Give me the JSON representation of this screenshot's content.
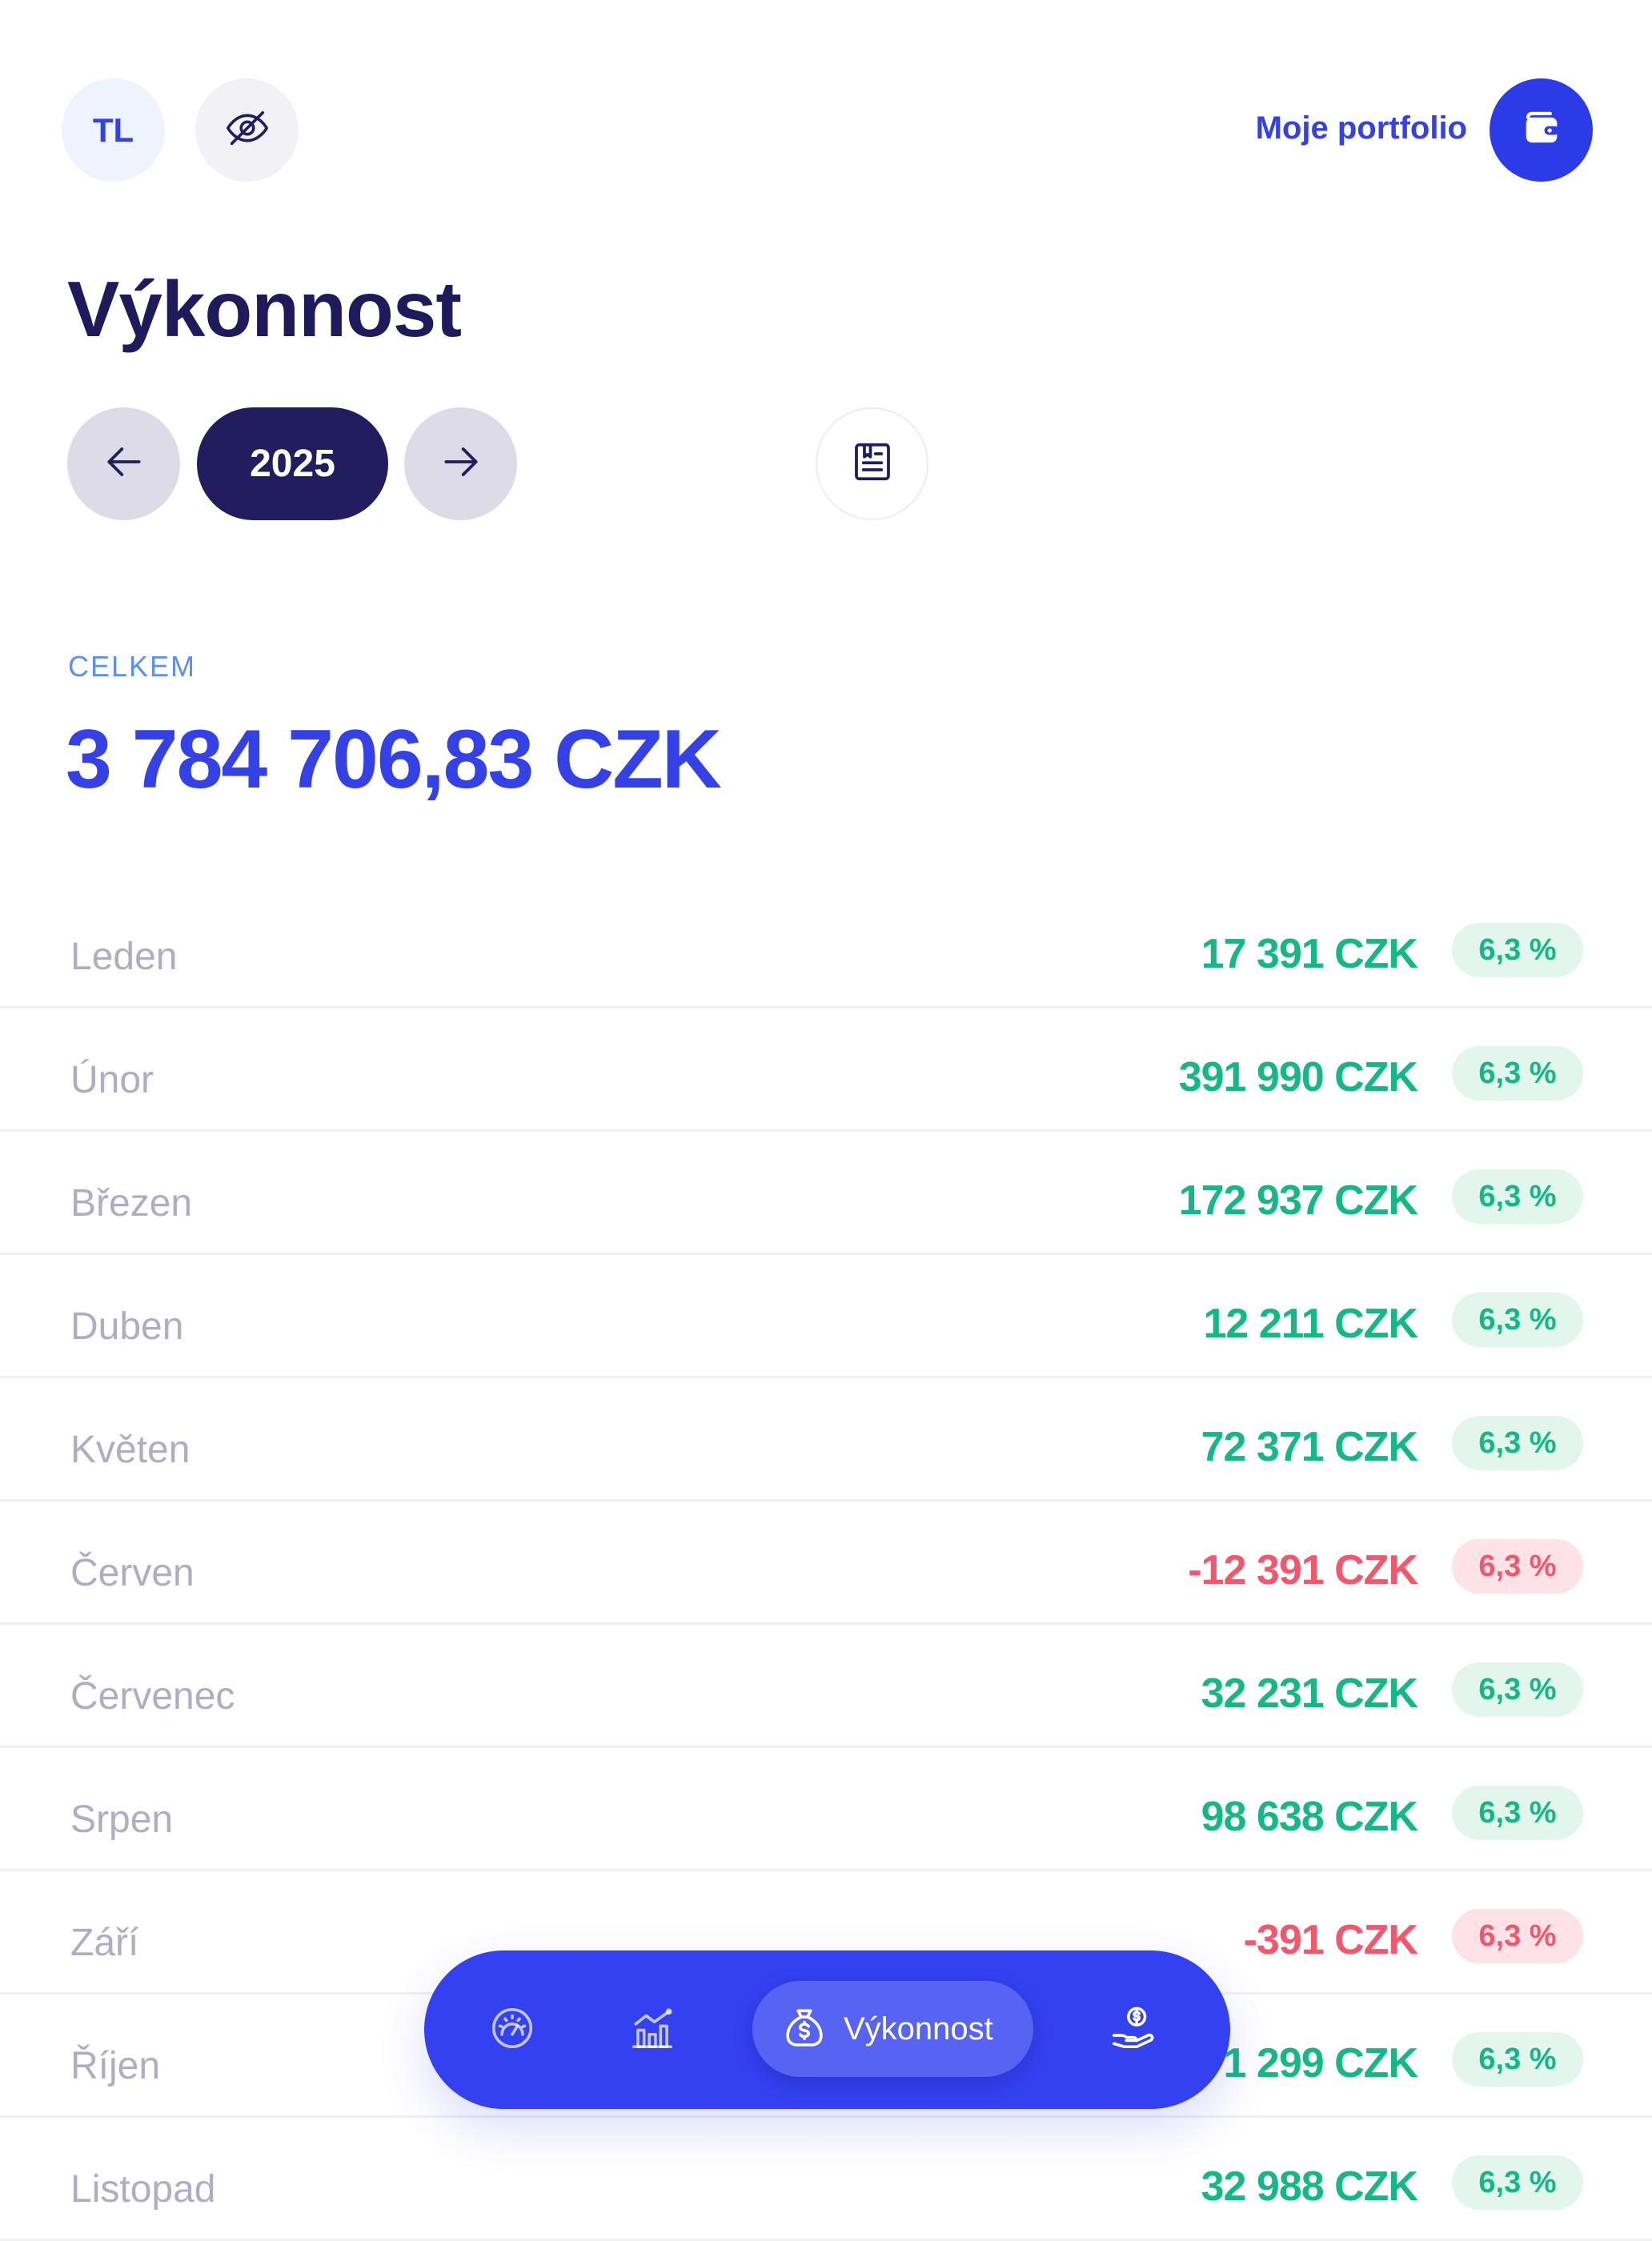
{
  "header": {
    "avatar_initials": "TL",
    "portfolio_label": "Moje portfolio"
  },
  "page": {
    "title": "Výkonnost",
    "year": "2025"
  },
  "total": {
    "label": "CELKEM",
    "value": "3 784 706,83 CZK"
  },
  "months": [
    {
      "name": "Leden",
      "amount": "17 391 CZK",
      "change": "6,3 %",
      "trend": "positive"
    },
    {
      "name": "Únor",
      "amount": "391 990 CZK",
      "change": "6,3 %",
      "trend": "positive"
    },
    {
      "name": "Březen",
      "amount": "172 937 CZK",
      "change": "6,3 %",
      "trend": "positive"
    },
    {
      "name": "Duben",
      "amount": "12 211 CZK",
      "change": "6,3 %",
      "trend": "positive"
    },
    {
      "name": "Květen",
      "amount": "72 371 CZK",
      "change": "6,3 %",
      "trend": "positive"
    },
    {
      "name": "Červen",
      "amount": "-12 391 CZK",
      "change": "6,3 %",
      "trend": "negative"
    },
    {
      "name": "Červenec",
      "amount": "32 231 CZK",
      "change": "6,3 %",
      "trend": "positive"
    },
    {
      "name": "Srpen",
      "amount": "98 638 CZK",
      "change": "6,3 %",
      "trend": "positive"
    },
    {
      "name": "Září",
      "amount": "-391 CZK",
      "change": "6,3 %",
      "trend": "negative"
    },
    {
      "name": "Říjen",
      "amount": "1 299 CZK",
      "change": "6,3 %",
      "trend": "positive"
    },
    {
      "name": "Listopad",
      "amount": "32 988 CZK",
      "change": "6,3 %",
      "trend": "positive"
    }
  ],
  "nav": {
    "active_label": "Výkonnost",
    "items": [
      "dashboard-icon",
      "chart-icon",
      "money-bag-icon",
      "hand-coin-icon"
    ]
  },
  "colors": {
    "accent": "#3341e6",
    "navy": "#221d5e",
    "positive": "#14b886",
    "negative": "#f4566b"
  }
}
